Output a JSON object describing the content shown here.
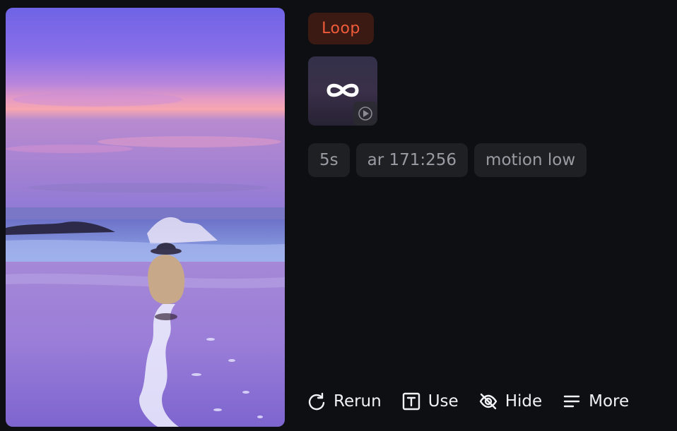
{
  "badge": {
    "label": "Loop",
    "accent": "#ef5b3a",
    "background": "#3a1a12"
  },
  "thumbnail": {
    "icon": "infinity-icon",
    "overlay_icon": "play-circle-icon"
  },
  "tags": [
    "5s",
    "ar 171:256",
    "motion low"
  ],
  "actions": [
    {
      "label": "Rerun",
      "icon": "rerun-icon"
    },
    {
      "label": "Use",
      "icon": "text-box-icon"
    },
    {
      "label": "Hide",
      "icon": "eye-off-icon"
    },
    {
      "label": "More",
      "icon": "menu-lines-icon"
    }
  ],
  "colors": {
    "background": "#0e0f12",
    "tag_bg": "#1e2024",
    "tag_text": "#9a9ca3"
  }
}
